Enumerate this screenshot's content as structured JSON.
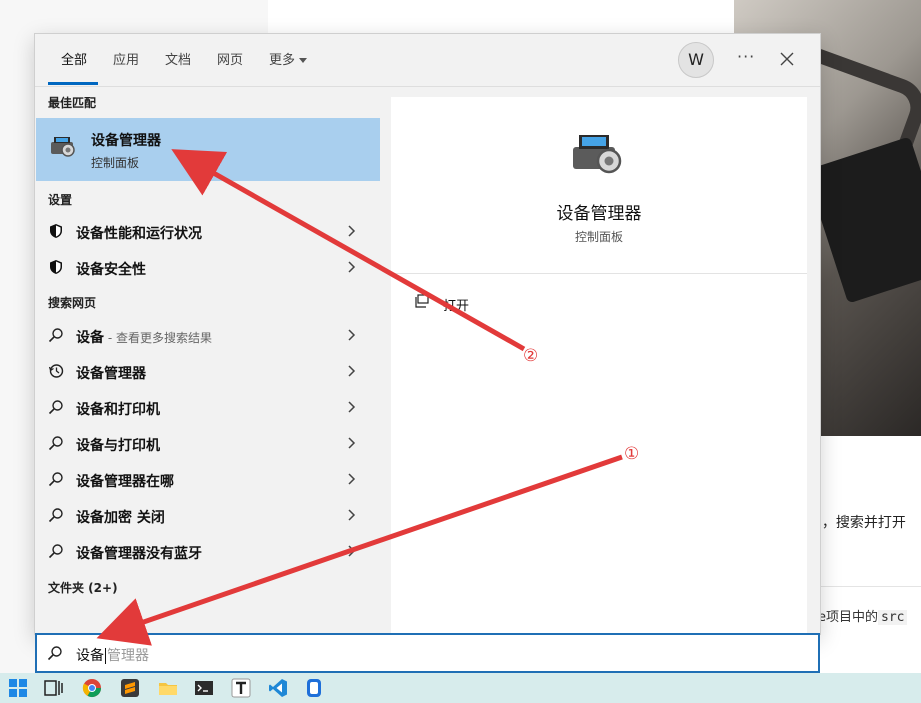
{
  "tabs": [
    {
      "label": "全部"
    },
    {
      "label": "应用"
    },
    {
      "label": "文档"
    },
    {
      "label": "网页"
    },
    {
      "label": "更多"
    }
  ],
  "header": {
    "avatar_initial": "W",
    "more_label": "···"
  },
  "sections": {
    "best_match": "最佳匹配",
    "settings": "设置",
    "web": "搜索网页",
    "folders": "文件夹 (2+)"
  },
  "best_match": {
    "title": "设备管理器",
    "subtitle": "控制面板"
  },
  "settings_items": [
    {
      "label": "设备性能和运行状况"
    },
    {
      "label": "设备安全性"
    }
  ],
  "web_items": [
    {
      "bold": "设备",
      "hint": " - 查看更多搜索结果"
    },
    {
      "bold": "设备管理器",
      "hint": ""
    },
    {
      "bold": "设备和打印机",
      "hint": ""
    },
    {
      "bold": "设备与打印机",
      "hint": ""
    },
    {
      "bold": "设备管理器在哪",
      "hint": ""
    },
    {
      "bold": "设备加密 关闭",
      "hint": ""
    },
    {
      "bold": "设备管理器没有蓝牙",
      "hint": ""
    }
  ],
  "preview": {
    "title": "设备管理器",
    "subtitle": "控制面板",
    "action_open": "打开"
  },
  "search": {
    "typed": "设备",
    "suggestion": "管理器"
  },
  "background": {
    "text1": "l，搜索并打开",
    "text2_pre": "e项目中的",
    "text2_code": "src"
  },
  "annotations": {
    "marker1": "①",
    "marker2": "②"
  },
  "colors": {
    "accent": "#0067c0",
    "highlight": "#a9cfee",
    "annotation": "#e23a3a"
  }
}
